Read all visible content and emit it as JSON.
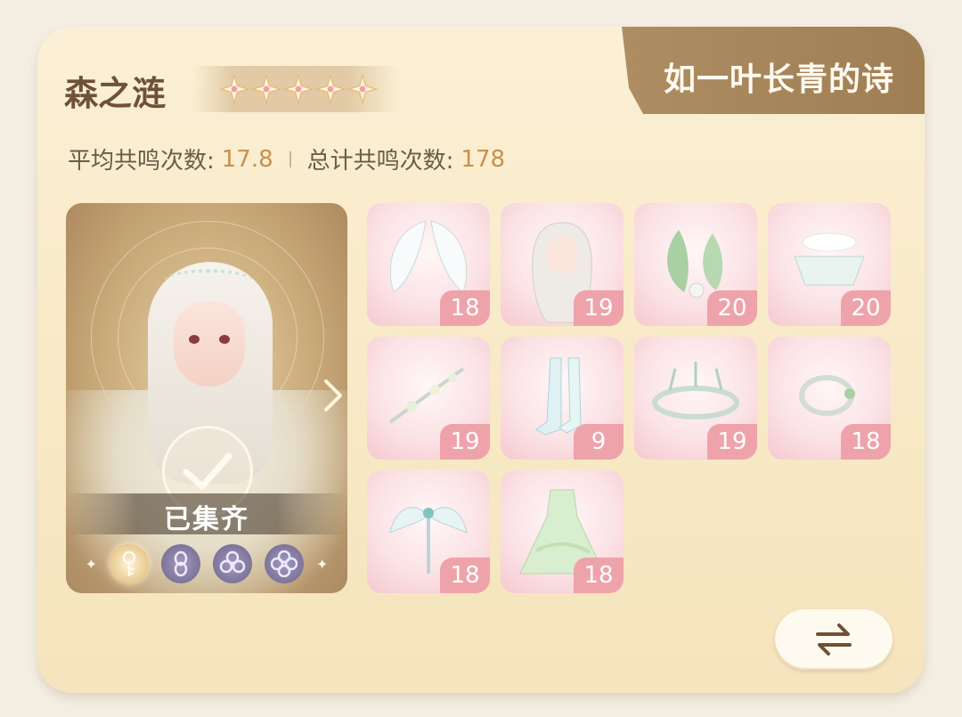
{
  "header": {
    "name": "森之涟",
    "star_count": 5,
    "banner_title": "如一叶长青的诗"
  },
  "stats": {
    "avg_label": "平均共鸣次数:",
    "avg_value": "17.8",
    "total_label": "总计共鸣次数:",
    "total_value": "178"
  },
  "portrait": {
    "status_text": "已集齐",
    "abilities": [
      {
        "icon": "key-icon",
        "state": "active"
      },
      {
        "icon": "infinity-icon",
        "state": "locked"
      },
      {
        "icon": "clover-icon",
        "state": "locked"
      },
      {
        "icon": "flower-icon",
        "state": "locked"
      }
    ]
  },
  "items": [
    {
      "icon": "wings-icon",
      "count": "18"
    },
    {
      "icon": "hair-icon",
      "count": "19"
    },
    {
      "icon": "leaf-earrings-icon",
      "count": "20"
    },
    {
      "icon": "collar-icon",
      "count": "20"
    },
    {
      "icon": "branch-hairpin-icon",
      "count": "19"
    },
    {
      "icon": "boots-icon",
      "count": "9"
    },
    {
      "icon": "tiara-icon",
      "count": "19"
    },
    {
      "icon": "bracelet-icon",
      "count": "18"
    },
    {
      "icon": "wand-icon",
      "count": "18"
    },
    {
      "icon": "dress-icon",
      "count": "18"
    }
  ],
  "colors": {
    "accent_gold": "#c8914c",
    "ribbon_brown": "#a88659",
    "count_pink": "#eea3ab"
  }
}
